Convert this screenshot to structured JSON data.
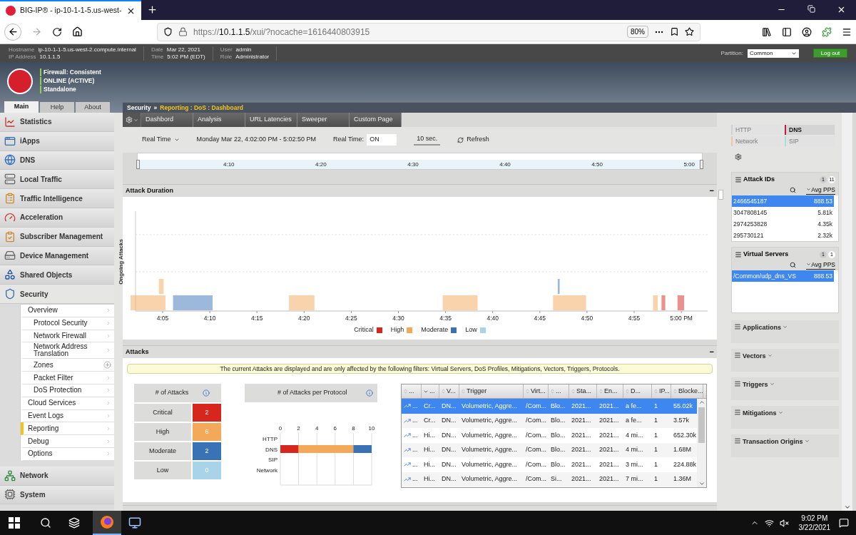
{
  "browser": {
    "tab_title": "BIG-IP® - ip-10-1-1-5.us-west-",
    "url_scheme": "https://",
    "url_host": "10.1.1.5",
    "url_path": "/xui/?nocache=1616440803915",
    "zoom": "80%"
  },
  "info_groups": [
    {
      "fields": [
        {
          "label": "Hostname",
          "value": "ip-10-1-1-5.us-west-2.compute.internal"
        },
        {
          "label": "IP Address",
          "value": "10.1.1.5"
        }
      ]
    },
    {
      "fields": [
        {
          "label": "Date",
          "value": "Mar 22, 2021"
        },
        {
          "label": "Time",
          "value": "5:02 PM (EDT)"
        }
      ]
    },
    {
      "fields": [
        {
          "label": "User",
          "value": "admin"
        },
        {
          "label": "Role",
          "value": "Administrator"
        }
      ]
    }
  ],
  "partition": {
    "label": "Partition:",
    "value": "Common"
  },
  "logout": "Log out",
  "status": [
    "Firewall: Consistent",
    "ONLINE (ACTIVE)",
    "Standalone"
  ],
  "main_tabs": [
    {
      "label": "Main",
      "selected": true
    },
    {
      "label": "Help",
      "selected": false
    },
    {
      "label": "About",
      "selected": false
    }
  ],
  "sidebar": {
    "items": [
      {
        "label": "Statistics",
        "expanded": false
      },
      {
        "label": "iApps",
        "expanded": false
      },
      {
        "label": "DNS",
        "expanded": false
      },
      {
        "label": "Local Traffic",
        "expanded": false
      },
      {
        "label": "Traffic Intelligence",
        "expanded": false
      },
      {
        "label": "Acceleration",
        "expanded": false
      },
      {
        "label": "Subscriber Management",
        "expanded": false
      },
      {
        "label": "Device Management",
        "expanded": false
      },
      {
        "label": "Shared Objects",
        "expanded": false
      },
      {
        "label": "Security",
        "expanded": true,
        "children": [
          {
            "label": "Overview",
            "kind": "arrow",
            "selected": false,
            "children": [
              {
                "label": "Protocol Security",
                "kind": "arrow",
                "selected": false
              },
              {
                "label": "Network Firewall",
                "kind": "arrow",
                "selected": false
              },
              {
                "label": "Network Address Translation",
                "kind": "arrow",
                "selected": false
              },
              {
                "label": "Zones",
                "kind": "add",
                "selected": false
              },
              {
                "label": "Packet Filter",
                "kind": "arrow",
                "selected": false
              },
              {
                "label": "DoS Protection",
                "kind": "arrow",
                "selected": false
              }
            ]
          },
          {
            "label": "Cloud Services",
            "kind": "arrow",
            "selected": false
          },
          {
            "label": "Event Logs",
            "kind": "arrow",
            "selected": false
          },
          {
            "label": "Reporting",
            "kind": "arrow",
            "selected": true
          },
          {
            "label": "Debug",
            "kind": "arrow",
            "selected": false
          },
          {
            "label": "Options",
            "kind": "arrow",
            "selected": false
          }
        ]
      },
      {
        "label": "Network",
        "expanded": false
      },
      {
        "label": "System",
        "expanded": false
      }
    ]
  },
  "breadcrumb": {
    "section": "Security",
    "separator": "»",
    "path": "Reporting : DoS : Dashboard"
  },
  "toolbar_tabs": [
    "Dashbord",
    "Analysis",
    "URL Latencies",
    "Sweeper",
    "Custom Page"
  ],
  "controls": {
    "range_mode": "Real Time",
    "range": "Monday Mar 22, 4:02:00 PM - 5:02:50 PM",
    "realtime_label": "Real Time:",
    "realtime": {
      "label": "ON",
      "on": true
    },
    "interval": "10 sec.",
    "refresh": "Refresh"
  },
  "timeline": {
    "level": 1,
    "ticks": [
      "4:10",
      "4:20",
      "4:30",
      "4:40",
      "4:50",
      "5:00"
    ]
  },
  "attack_duration": {
    "title": "Attack Duration",
    "collapse": "−",
    "ylabel": "Ongoing Attacks",
    "time_labels": [
      "4:05",
      "4:10",
      "4:15",
      "4:20",
      "4:25",
      "4:30",
      "4:35",
      "4:40",
      "4:45",
      "4:50",
      "4:55",
      "5:00 PM"
    ],
    "legend": [
      {
        "label": "Critical",
        "color": "#d7261e"
      },
      {
        "label": "High",
        "color": "#f4a859"
      },
      {
        "label": "Moderate",
        "color": "#3a72b6"
      },
      {
        "label": "Low",
        "color": "#a9d3e8"
      }
    ]
  },
  "attacks": {
    "title": "Attacks",
    "collapse": "−",
    "notice": "The current Attacks are displayed and are only affected by the following filters: Virtual Servers, DoS Profiles, Mitigations, Vectors, Triggers, Protocols.",
    "counts": {
      "header": "# of Attacks",
      "rows": [
        {
          "label": "Critical",
          "value": "2",
          "color": "#d7261e"
        },
        {
          "label": "High",
          "value": "6",
          "color": "#f4a859"
        },
        {
          "label": "Moderate",
          "value": "2",
          "color": "#3a72b6"
        },
        {
          "label": "Low",
          "value": "0",
          "color": "#a9d3e8"
        }
      ]
    },
    "protocol_chart": {
      "title": "# of Attacks per Protocol",
      "chart_data": {
        "type": "bar",
        "orientation": "horizontal",
        "stacked": true,
        "grid": true,
        "categories": [
          "HTTP",
          "DNS",
          "SIP",
          "Network"
        ],
        "xticks": [
          0,
          2,
          4,
          6,
          8,
          10
        ],
        "xlim": [
          0,
          10
        ],
        "series": [
          {
            "color": "#d7261e",
            "values": [
              0,
              2,
              0,
              0
            ]
          },
          {
            "color": "#f4a859",
            "values": [
              0,
              6,
              0,
              0
            ]
          },
          {
            "color": "#3a72b6",
            "values": [
              0,
              2,
              0,
              0
            ]
          },
          {
            "color": "#a9d3e8",
            "values": [
              0,
              0,
              0,
              0
            ]
          }
        ]
      }
    },
    "table": {
      "columns": [
        {
          "label": "...",
          "sorted": false
        },
        {
          "label": "...",
          "sorted": true
        },
        {
          "label": "V...",
          "sorted": false
        },
        {
          "label": "Trigger",
          "sorted": false
        },
        {
          "label": "Virt...",
          "sorted": false
        },
        {
          "label": "...",
          "sorted": false
        },
        {
          "label": "Sta...",
          "sorted": false
        },
        {
          "label": "En...",
          "sorted": false
        },
        {
          "label": "D...",
          "sorted": false
        },
        {
          "label": "IP...",
          "sorted": false
        },
        {
          "label": "Blocke...",
          "sorted": false
        }
      ],
      "rows": [
        {
          "selected": true,
          "cells": [
            "...",
            "Cr...",
            "DN...",
            "Volumetric, Aggre...",
            "/Com...",
            "Blo...",
            "2021...",
            "2021...",
            "a fe...",
            "1",
            "55.02k"
          ]
        },
        {
          "selected": false,
          "cells": [
            "...",
            "Cr...",
            "DN...",
            "Volumetric, Aggre...",
            "/Com...",
            "Blo...",
            "2021...",
            "2021...",
            "a fe...",
            "1",
            "3.57k"
          ]
        },
        {
          "selected": false,
          "cells": [
            "...",
            "Hi...",
            "DN...",
            "Volumetric, Aggre...",
            "/Com...",
            "Blo...",
            "2021...",
            "2021...",
            "4 mi...",
            "1",
            "652.30k"
          ]
        },
        {
          "selected": false,
          "cells": [
            "...",
            "Hi...",
            "DN...",
            "Volumetric, Aggre...",
            "/Com...",
            "Blo...",
            "2021...",
            "2021...",
            "4 mi...",
            "1",
            "1.68M"
          ]
        },
        {
          "selected": false,
          "cells": [
            "...",
            "Hi...",
            "DN...",
            "Volumetric, Aggre...",
            "/Com...",
            "Blo...",
            "2021...",
            "2021...",
            "3 mi...",
            "1",
            "224.88k"
          ]
        },
        {
          "selected": false,
          "cells": [
            "...",
            "Hi...",
            "DN...",
            "Volumetric, Aggre...",
            "/Com...",
            "Si...",
            "2021...",
            "2021...",
            "7 mi...",
            "1",
            "1.36M"
          ]
        }
      ]
    }
  },
  "right_panel": {
    "protocols": [
      {
        "label": "HTTP",
        "selected": false,
        "color": "#d0d0d0"
      },
      {
        "label": "DNS",
        "selected": true,
        "color": "#c8184a"
      },
      {
        "label": "Network",
        "selected": false,
        "color": "#f0c8a0"
      },
      {
        "label": "SIP",
        "selected": false,
        "color": "#a8e0d8"
      }
    ],
    "filters": [
      {
        "title": "Attack IDs",
        "counts": [
          "1",
          "11"
        ],
        "column": "Avg PPS",
        "rows": [
          {
            "name": "2466545187",
            "value": "888.53",
            "selected": true
          },
          {
            "name": "3047808145",
            "value": "5.81k",
            "selected": false
          },
          {
            "name": "2974253828",
            "value": "4.35k",
            "selected": false
          },
          {
            "name": "295730121",
            "value": "2.32k",
            "selected": false
          }
        ]
      },
      {
        "title": "Virtual Servers",
        "counts": [
          "1",
          "1"
        ],
        "column": "Avg PPS",
        "rows": [
          {
            "name": "/Common/udp_dns_VS",
            "value": "888.53",
            "selected": true
          }
        ]
      }
    ],
    "sections": [
      "Applications",
      "Vectors",
      "Triggers",
      "Mitigations",
      "Transaction Origins"
    ]
  },
  "taskbar": {
    "time": "9:02 PM",
    "date": "3/22/2021"
  }
}
